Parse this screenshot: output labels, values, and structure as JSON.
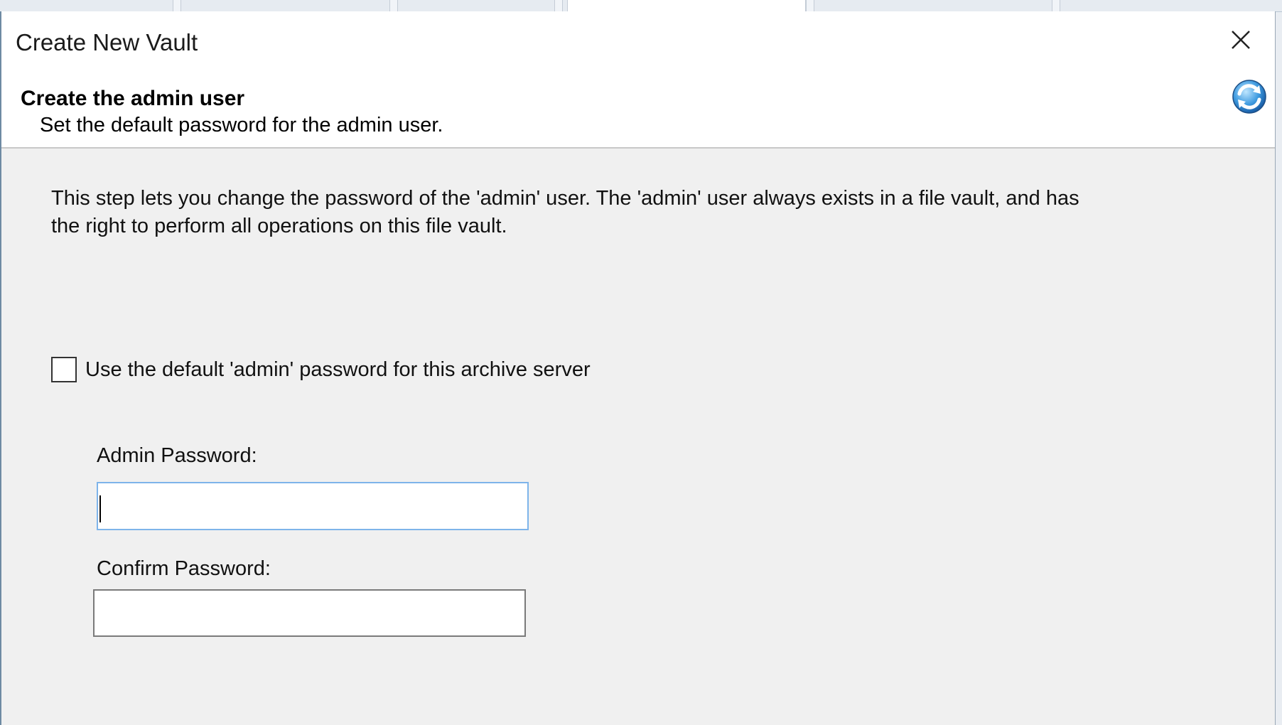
{
  "dialog": {
    "title": "Create New Vault",
    "close_icon": "close-icon"
  },
  "header": {
    "title": "Create the admin user",
    "subtitle": "Set the default password for the admin user.",
    "icon": "refresh-globe-icon"
  },
  "body": {
    "description": "This step lets you change the password of the 'admin' user. The 'admin' user always exists in a file vault, and has the right to perform all operations on this file vault.",
    "use_default_checkbox": {
      "label": "Use the default 'admin' password for this archive server",
      "checked": false
    },
    "admin_password": {
      "label": "Admin Password:",
      "value": ""
    },
    "confirm_password": {
      "label": "Confirm Password:",
      "value": ""
    }
  },
  "colors": {
    "focus_border": "#7eb4ea",
    "dialog_bg": "#f0f0f0",
    "header_bg": "#ffffff"
  }
}
